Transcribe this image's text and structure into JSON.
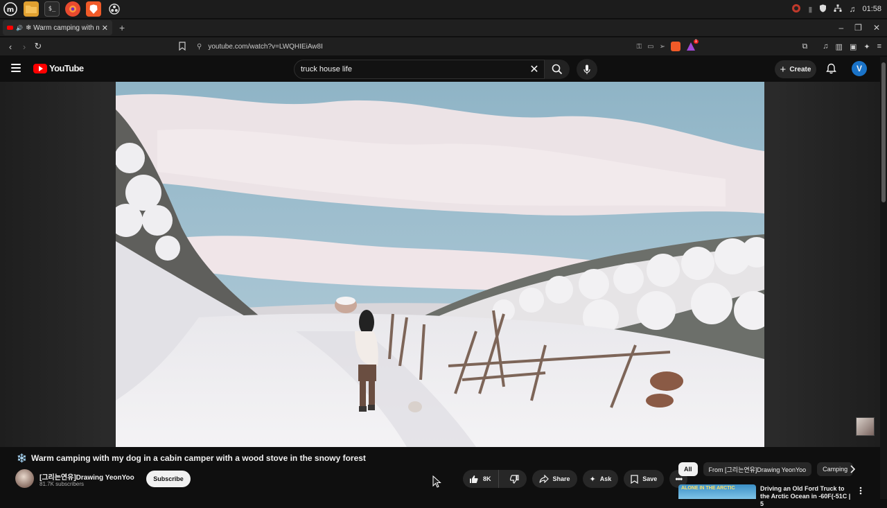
{
  "os": {
    "time": "01:58"
  },
  "browser": {
    "tab_title": "❄ Warm camping with my dog",
    "url": "youtube.com/watch?v=LWQHIEiAw8I",
    "ext_badge": "1"
  },
  "youtube": {
    "logo_text": "YouTube",
    "search_value": "truck house life",
    "create_label": "Create",
    "avatar_letter": "V"
  },
  "video": {
    "title_emoji": "❄️",
    "title": "Warm camping with my dog in a cabin camper with a wood stove in the snowy forest",
    "channel": "[그리는연유]Drawing YeonYoo",
    "subscribers": "81.7K subscribers",
    "subscribe_label": "Subscribe",
    "likes": "8K",
    "share_label": "Share",
    "ask_label": "Ask",
    "save_label": "Save"
  },
  "sidebar": {
    "chips": [
      "All",
      "From [그리는연유]Drawing YeonYoo",
      "Camping"
    ],
    "rec": {
      "thumb_text": "ALONE IN THE ARCTIC",
      "title": "Driving an Old Ford Truck to the Arctic Ocean in -60F(-51C | 5"
    }
  },
  "colors": {
    "yt_red": "#ff0000",
    "background": "#0f0f0f",
    "avatar_blue": "#1a73c8"
  }
}
